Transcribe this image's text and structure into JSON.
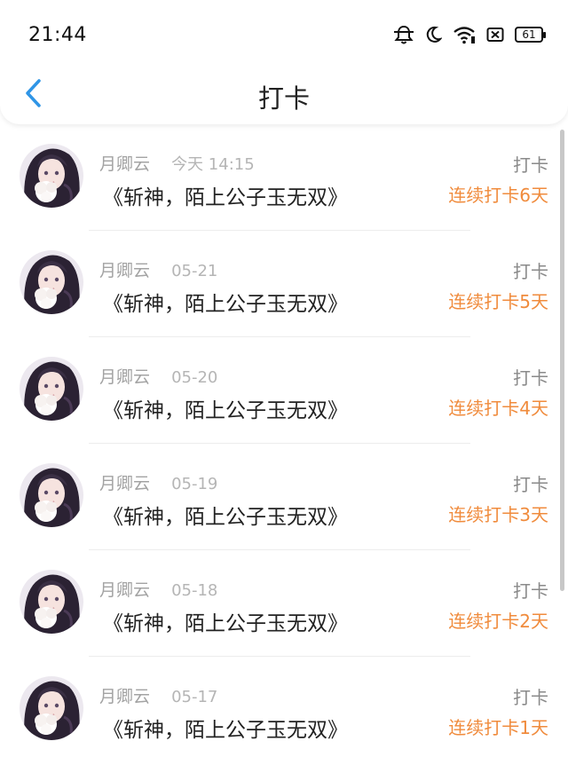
{
  "status_bar": {
    "time": "21:44",
    "battery": "61",
    "icons": [
      "mute-bell-icon",
      "moon-icon",
      "wifi-icon",
      "sim-off-icon",
      "battery-icon"
    ]
  },
  "nav": {
    "title": "打卡",
    "back_icon": "chevron-left-icon",
    "accent_color": "#2f95e6"
  },
  "colors": {
    "streak": "#f08b3c",
    "meta": "#a3a3a3",
    "text": "#222222"
  },
  "entries": [
    {
      "user": "月卿云",
      "date": "今天 14:15",
      "book": "《斩神，陌上公子玉无双》",
      "action": "打卡",
      "streak": "连续打卡6天"
    },
    {
      "user": "月卿云",
      "date": "05-21",
      "book": "《斩神，陌上公子玉无双》",
      "action": "打卡",
      "streak": "连续打卡5天"
    },
    {
      "user": "月卿云",
      "date": "05-20",
      "book": "《斩神，陌上公子玉无双》",
      "action": "打卡",
      "streak": "连续打卡4天"
    },
    {
      "user": "月卿云",
      "date": "05-19",
      "book": "《斩神，陌上公子玉无双》",
      "action": "打卡",
      "streak": "连续打卡3天"
    },
    {
      "user": "月卿云",
      "date": "05-18",
      "book": "《斩神，陌上公子玉无双》",
      "action": "打卡",
      "streak": "连续打卡2天"
    },
    {
      "user": "月卿云",
      "date": "05-17",
      "book": "《斩神，陌上公子玉无双》",
      "action": "打卡",
      "streak": "连续打卡1天"
    }
  ]
}
